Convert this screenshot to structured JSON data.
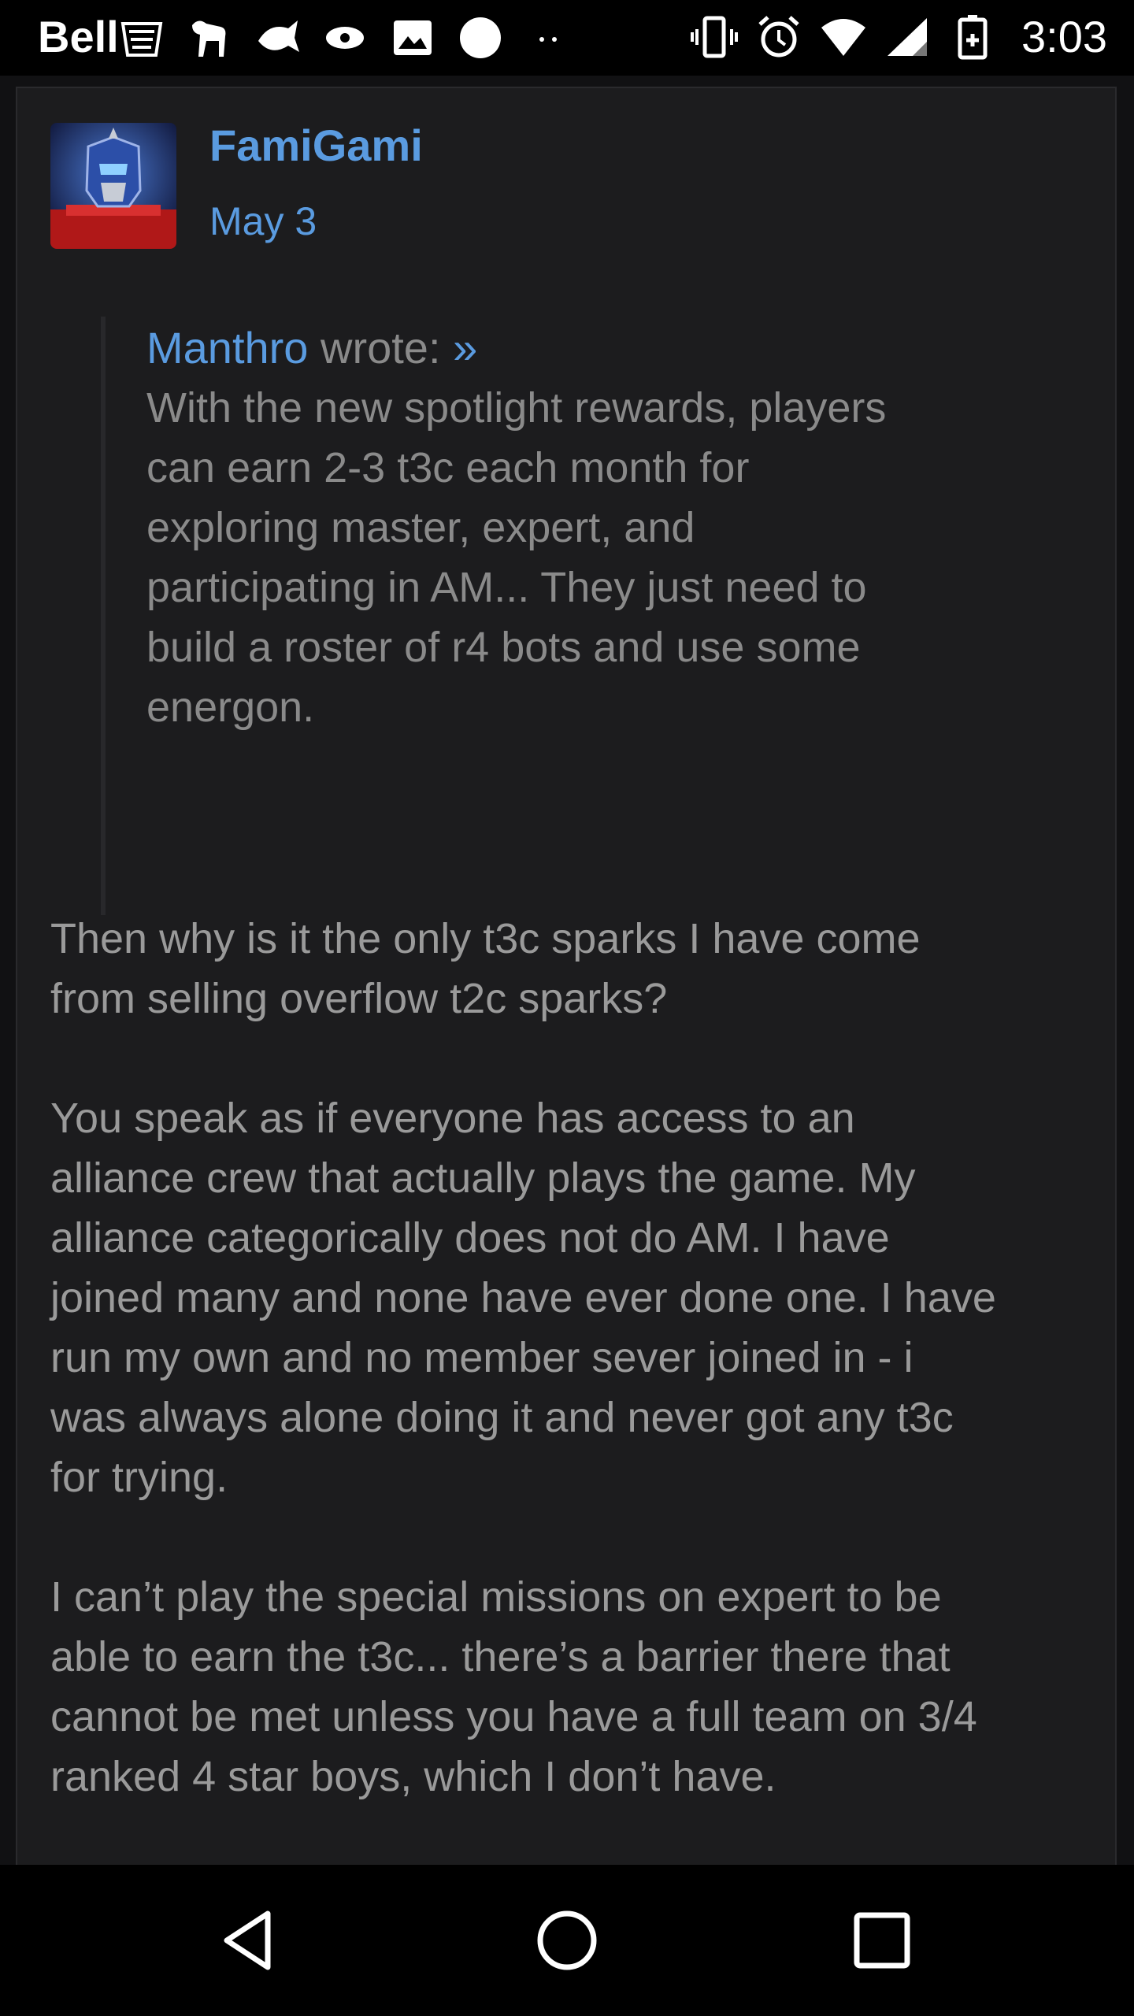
{
  "status_bar": {
    "carrier": "Bell",
    "time": "3:03",
    "notification_icons": [
      "starbucks-icon",
      "dog-icon",
      "fish-icon",
      "blob-icon",
      "image-icon",
      "circle-icon",
      "more-dots-icon"
    ],
    "system_icons": [
      "vibrate-icon",
      "alarm-icon",
      "wifi-icon",
      "signal-icon",
      "battery-charging-icon"
    ]
  },
  "post": {
    "author": "FamiGami",
    "date": "May 3",
    "quote": {
      "author": "Manthro",
      "wrote_label": "wrote:",
      "arrow": "»",
      "text": "With the new spotlight rewards, players\ncan earn 2-3 t3c each month for\nexploring master, expert, and\nparticipating in AM... They just need to\nbuild a roster of r4 bots and use some\nenergon."
    },
    "paragraphs": [
      "Then why is it the only t3c sparks I have come\nfrom selling overflow t2c sparks?",
      "You speak as if everyone has access to an\nalliance crew that actually plays the game. My\nalliance categorically does not do AM. I have\njoined many and none have ever done one. I have\nrun my own and no member sever joined in - i\nwas always alone doing it and never got any t3c\nfor trying.",
      "I can’t play the special missions on expert to be\nable to earn the t3c... there’s a barrier there that\ncannot be met unless you have a full team on 3/4\nranked 4 star boys, which I don’t have."
    ]
  },
  "nav_bar": {
    "buttons": [
      "back-icon",
      "home-icon",
      "recents-icon"
    ]
  },
  "colors": {
    "link": "#5a9be0",
    "text": "#9a9a9a",
    "card": "#1c1c1e",
    "background": "#111113"
  }
}
